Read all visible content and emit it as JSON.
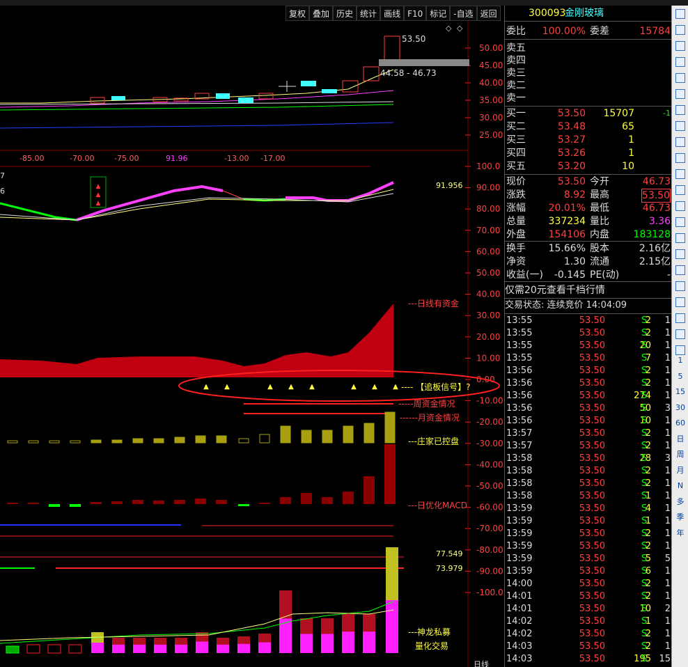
{
  "toolbar": [
    "复权",
    "叠加",
    "历史",
    "统计",
    "画线",
    "F10",
    "标记",
    "-自选",
    "返回"
  ],
  "stock": {
    "code": "300093",
    "name": "金刚玻璃"
  },
  "main_chart": {
    "price_ticks": [
      "50.00",
      "45.00",
      "40.00",
      "35.00",
      "30.00",
      "25.00"
    ],
    "price_label_high": "53.50",
    "price_label_range": "44.58 - 46.73"
  },
  "osc_bar": [
    "-85.00",
    "-70.00",
    "-75.00",
    "91.96",
    "-13.00",
    "-17.00"
  ],
  "left_cut_labels": [
    "7",
    "6"
  ],
  "indicator_value": "91.956",
  "right_axis": [
    "100.0",
    "90.00",
    "80.00",
    "70.00",
    "60.00",
    "50.00",
    "40.00",
    "30.00",
    "20.00",
    "10.00",
    "0.00",
    "-10.00",
    "-20.00",
    "-30.00",
    "-40.00",
    "-50.00",
    "-60.00",
    "-70.00",
    "-80.00",
    "-90.00",
    "-100.0"
  ],
  "annotations": {
    "daily_hot_money": "---日线有资金",
    "chase_signal": "---- 【追板信号】?",
    "weekly": "-----周资金情况",
    "monthly": "------月资金情况",
    "controlled": "---庄家已控盘",
    "macd": "---日优化MACD",
    "dragon": "---神龙私募",
    "quant": "量化交易",
    "val1": "77.549",
    "val2": "73.979",
    "bottom_cut": "日线"
  },
  "quote": {
    "webi_label": "委比",
    "webi_val": "100.00%",
    "weicha_label": "委差",
    "weicha_val": "15784",
    "asks": [
      {
        "label": "卖五"
      },
      {
        "label": "卖四"
      },
      {
        "label": "卖三"
      },
      {
        "label": "卖二"
      },
      {
        "label": "卖一"
      }
    ],
    "bids": [
      {
        "label": "买一",
        "price": "53.50",
        "vol": "15707",
        "chg": "-1"
      },
      {
        "label": "买二",
        "price": "53.48",
        "vol": "65",
        "chg": ""
      },
      {
        "label": "买三",
        "price": "53.27",
        "vol": "1",
        "chg": ""
      },
      {
        "label": "买四",
        "price": "53.26",
        "vol": "1",
        "chg": ""
      },
      {
        "label": "买五",
        "price": "53.20",
        "vol": "10",
        "chg": ""
      }
    ],
    "stats": [
      {
        "l1": "现价",
        "v1": "53.50",
        "l2": "今开",
        "v2": "46.73",
        "c1": "red",
        "c2": "red"
      },
      {
        "l1": "涨跌",
        "v1": "8.92",
        "l2": "最高",
        "v2": "53.50",
        "c1": "red",
        "c2": "red"
      },
      {
        "l1": "涨幅",
        "v1": "20.01%",
        "l2": "最低",
        "v2": "46.73",
        "c1": "red",
        "c2": "red"
      },
      {
        "l1": "总量",
        "v1": "337234",
        "l2": "量比",
        "v2": "3.36",
        "c1": "yel",
        "c2": "mag"
      },
      {
        "l1": "外盘",
        "v1": "154106",
        "l2": "内盘",
        "v2": "183128",
        "c1": "red",
        "c2": "grn"
      }
    ],
    "stats2": [
      {
        "l1": "换手",
        "v1": "15.66%",
        "l2": "股本",
        "v2": "2.16亿"
      },
      {
        "l1": "净资",
        "v1": "1.30",
        "l2": "流通",
        "v2": "2.15亿"
      },
      {
        "l1": "收益(一)",
        "v1": "-0.145",
        "l2": "PE(动)",
        "v2": "-"
      }
    ],
    "promo": "仅需20元查看千档行情",
    "trade_status": "交易状态: 连续竞价 14:04:09"
  },
  "ticks": [
    [
      "13:55",
      "53.50",
      "2",
      "S",
      "1"
    ],
    [
      "13:55",
      "53.50",
      "2",
      "S",
      "1"
    ],
    [
      "13:55",
      "53.50",
      "20",
      "S",
      "1"
    ],
    [
      "13:55",
      "53.50",
      "7",
      "S",
      "1"
    ],
    [
      "13:56",
      "53.50",
      "2",
      "S",
      "1"
    ],
    [
      "13:56",
      "53.50",
      "2",
      "S",
      "1"
    ],
    [
      "13:56",
      "53.50",
      "274",
      "S",
      "1"
    ],
    [
      "13:56",
      "53.50",
      "50",
      "S",
      "3"
    ],
    [
      "13:56",
      "53.50",
      "10",
      "S",
      "1"
    ],
    [
      "13:57",
      "53.50",
      "2",
      "S",
      "1"
    ],
    [
      "13:57",
      "53.50",
      "2",
      "S",
      "1"
    ],
    [
      "13:58",
      "53.50",
      "28",
      "S",
      "3"
    ],
    [
      "13:58",
      "53.50",
      "2",
      "S",
      "1"
    ],
    [
      "13:58",
      "53.50",
      "2",
      "S",
      "1"
    ],
    [
      "13:58",
      "53.50",
      "1",
      "S",
      "1"
    ],
    [
      "13:59",
      "53.50",
      "4",
      "S",
      "1"
    ],
    [
      "13:59",
      "53.50",
      "1",
      "S",
      "1"
    ],
    [
      "13:59",
      "53.50",
      "2",
      "S",
      "1"
    ],
    [
      "13:59",
      "53.50",
      "2",
      "S",
      "1"
    ],
    [
      "13:59",
      "53.50",
      "5",
      "S",
      "5"
    ],
    [
      "13:59",
      "53.50",
      "6",
      "S",
      "1"
    ],
    [
      "14:00",
      "53.50",
      "2",
      "S",
      "1"
    ],
    [
      "14:01",
      "53.50",
      "2",
      "S",
      "1"
    ],
    [
      "14:01",
      "53.50",
      "10",
      "S",
      "2"
    ],
    [
      "14:02",
      "53.50",
      "1",
      "S",
      "1"
    ],
    [
      "14:02",
      "53.50",
      "2",
      "S",
      "1"
    ],
    [
      "14:03",
      "53.50",
      "2",
      "S",
      "1"
    ],
    [
      "14:03",
      "53.50",
      "195",
      "S",
      "15"
    ]
  ],
  "sidebar_text": [
    "1",
    "5",
    "15",
    "30",
    "60",
    "日",
    "周",
    "月",
    "N",
    "多",
    "季",
    "年"
  ]
}
